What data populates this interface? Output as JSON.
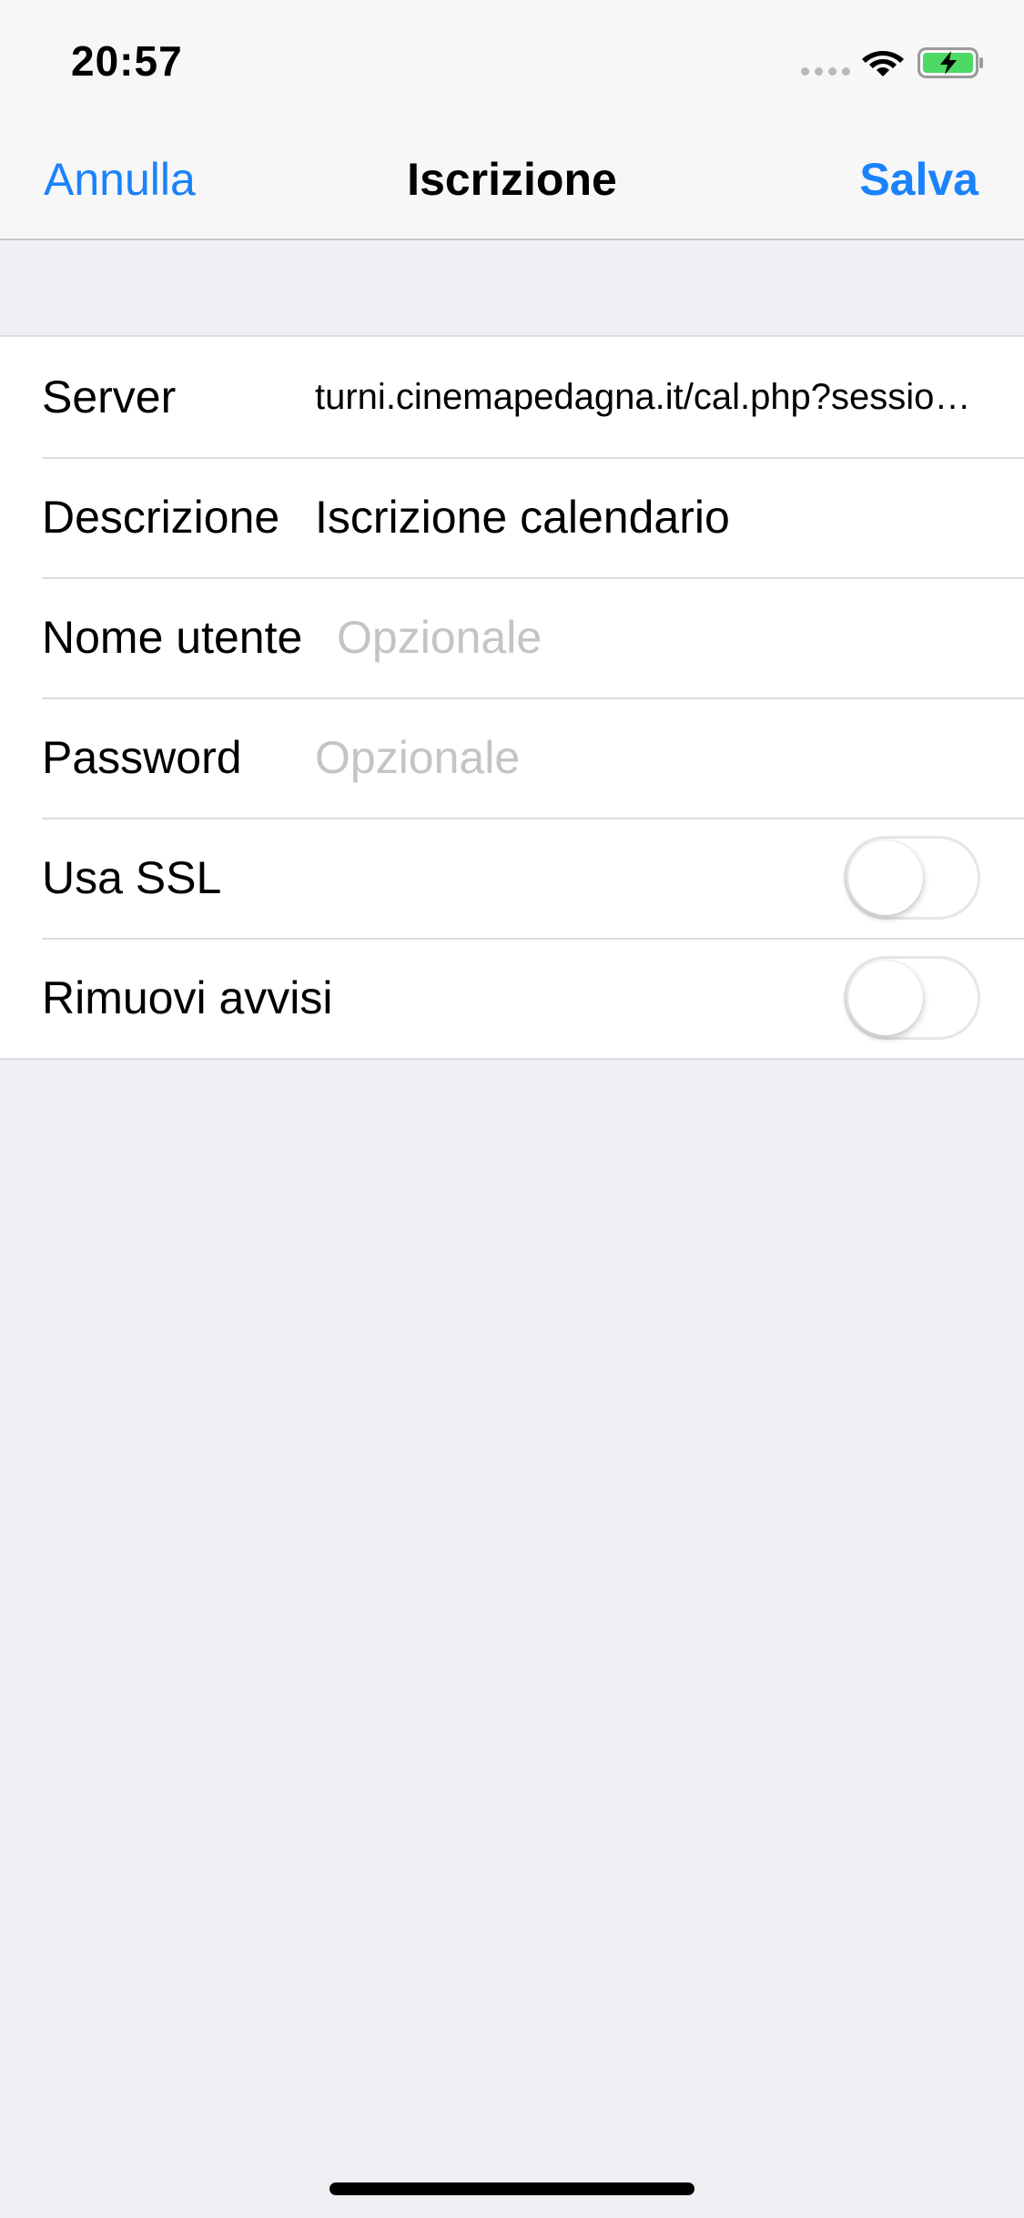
{
  "status_bar": {
    "time": "20:57",
    "icons": [
      "signal-dots-icon",
      "wifi-icon",
      "battery-charging-icon"
    ],
    "battery_color": "#4cd964"
  },
  "nav": {
    "cancel_label": "Annulla",
    "title": "Iscrizione",
    "save_label": "Salva",
    "accent_color": "#1a82fb"
  },
  "form": {
    "server": {
      "label": "Server",
      "value": "turni.cinemapedagna.it/cal.php?session=sub"
    },
    "description": {
      "label": "Descrizione",
      "value": "Iscrizione calendario"
    },
    "username": {
      "label": "Nome utente",
      "placeholder": "Opzionale"
    },
    "password": {
      "label": "Password",
      "placeholder": "Opzionale"
    },
    "ssl": {
      "label": "Usa SSL",
      "on": false
    },
    "remove_alerts": {
      "label": "Rimuovi avvisi",
      "on": false
    }
  }
}
